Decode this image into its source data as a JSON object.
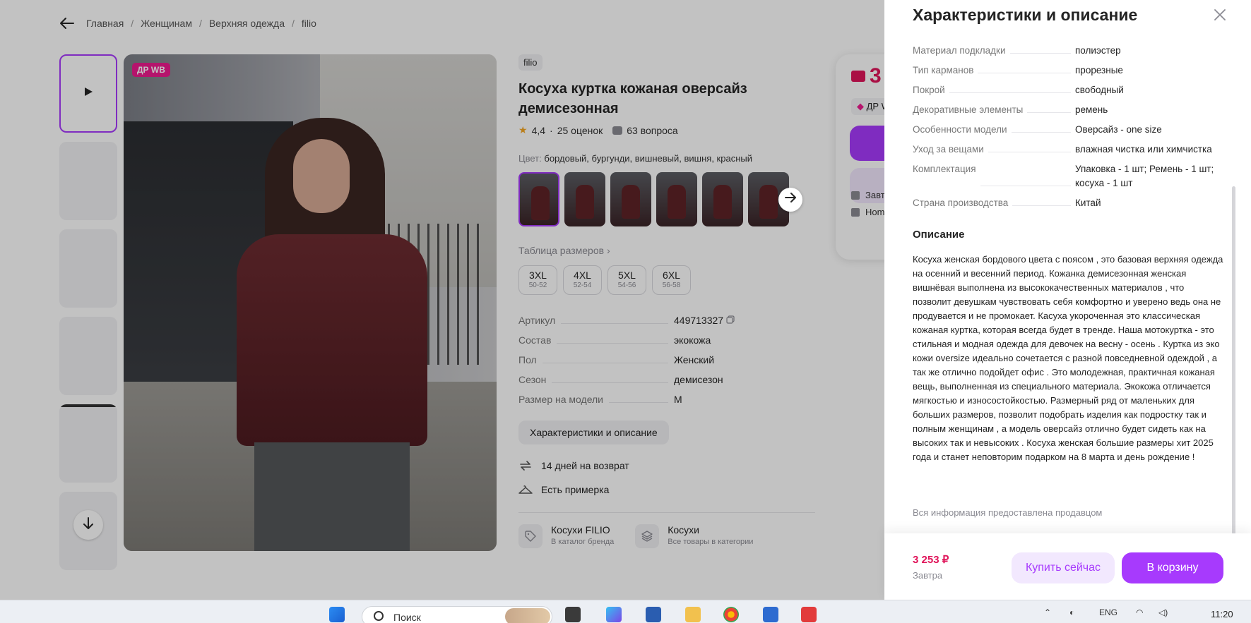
{
  "breadcrumb": {
    "items": [
      "Главная",
      "Женщинам",
      "Верхняя одежда",
      "filio"
    ],
    "separator": "/"
  },
  "media": {
    "badge": "ДР WB"
  },
  "product": {
    "brand": "filio",
    "title": "Косуха куртка кожаная оверсайз демисезонная",
    "rating": "4,4",
    "rating_sep": "·",
    "reviews": "25 оценок",
    "questions": "63 вопроса",
    "color_label": "Цвет:",
    "color_value": "бордовый, бургунди, вишневый, вишня, красный",
    "size_table_link": "Таблица размеров",
    "sizes": [
      {
        "size": "3XL",
        "range": "50-52"
      },
      {
        "size": "4XL",
        "range": "52-54"
      },
      {
        "size": "5XL",
        "range": "54-56"
      },
      {
        "size": "6XL",
        "range": "56-58"
      }
    ],
    "specs": [
      {
        "key": "Артикул",
        "value": "449713327"
      },
      {
        "key": "Состав",
        "value": "экокожа"
      },
      {
        "key": "Пол",
        "value": "Женский"
      },
      {
        "key": "Сезон",
        "value": "демисезон"
      },
      {
        "key": "Размер на модели",
        "value": "M"
      }
    ],
    "characteristics_button": "Характеристики и описание",
    "features": [
      {
        "icon": "return-arrows-icon",
        "label": "14 дней на возврат"
      },
      {
        "icon": "hanger-icon",
        "label": "Есть примерка"
      }
    ],
    "links": [
      {
        "icon": "tag-icon",
        "title": "Косухи FILIO",
        "subtitle": "В каталог бренда"
      },
      {
        "icon": "layers-icon",
        "title": "Косухи",
        "subtitle": "Все товары в категории"
      }
    ]
  },
  "buy_card": {
    "price_partial": "3",
    "badge_partial": "ДР W",
    "delivery_partial": "Завт",
    "pickup_partial": "Hom"
  },
  "panel": {
    "title": "Характеристики и описание",
    "specs": [
      {
        "key": "Материал подкладки",
        "value": "полиэстер"
      },
      {
        "key": "Тип карманов",
        "value": "прорезные"
      },
      {
        "key": "Покрой",
        "value": "свободный"
      },
      {
        "key": "Декоративные элементы",
        "value": "ремень"
      },
      {
        "key": "Особенности модели",
        "value": "Оверсайз - one size"
      },
      {
        "key": "Уход за вещами",
        "value": "влажная чистка или химчистка"
      },
      {
        "key": "Комплектация",
        "value": "Упаковка - 1 шт; Ремень - 1 шт; косуха - 1 шт"
      },
      {
        "key": "Страна производства",
        "value": "Китай"
      }
    ],
    "description_title": "Описание",
    "description": "Косуха женская бордового цвета с поясом , это базовая верхняя одежда на осенний и весенний период. Кожанка демисезонная женская вишнёвая выполнена из высококачественных материалов , что позволит девушкам чувствовать себя комфортно и уверено ведь она не продувается и не промокает. Касуха укороченная это классическая кожаная куртка, которая всегда будет в тренде. Наша мотокуртка - это стильная и модная одежда для девочек на весну - осень . Куртка из эко кожи oversize идеально сочетается с разной повседневной одеждой , а так же отлично подойдет офис . Это молодежная, практичная кожаная вещь, выполненная из специального материала. Экокожа отличается мягкостью и износостойкостью. Размерный ряд от маленьких для больших размеров, позволит подобрать изделия как подростку так и полным женщинам , а модель оверсайз отлично будет сидеть как на высоких так и невысоких . Косуха женская большие размеры хит 2025 года и станет неповторим подарком на 8 марта и день рождение !",
    "seller_note": "Вся информация предоставлена продавцом",
    "footer": {
      "price": "3 253 ₽",
      "delivery": "Завтра",
      "buy_now": "Купить сейчас",
      "add_to_cart": "В корзину"
    }
  },
  "taskbar": {
    "search_placeholder": "Поиск",
    "language": "ENG",
    "time": "11:20"
  },
  "colors": {
    "accent": "#a73afd",
    "accent_light": "#f2e8fe",
    "price": "#e0155a",
    "badge": "#ee1b8e"
  }
}
